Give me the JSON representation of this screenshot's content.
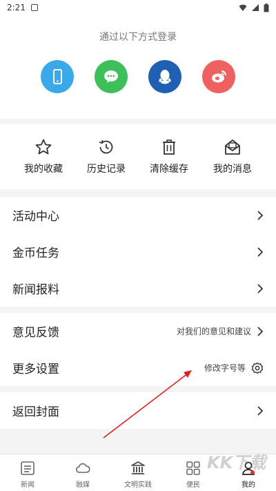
{
  "status_bar": {
    "time": "2:21"
  },
  "login": {
    "title": "通过以下方式登录",
    "methods": [
      {
        "name": "phone",
        "icon": "phone-icon",
        "color": "#3aa9ea"
      },
      {
        "name": "wechat",
        "icon": "wechat-icon",
        "color": "#3dbf5a"
      },
      {
        "name": "qq",
        "icon": "qq-icon",
        "color": "#1f60b5"
      },
      {
        "name": "weibo",
        "icon": "weibo-icon",
        "color": "#ef6060"
      }
    ]
  },
  "quick_actions": [
    {
      "label": "我的收藏",
      "icon": "star-icon"
    },
    {
      "label": "历史记录",
      "icon": "history-icon"
    },
    {
      "label": "清除缓存",
      "icon": "trash-icon"
    },
    {
      "label": "我的消息",
      "icon": "mail-icon"
    }
  ],
  "menu_group1": [
    {
      "label": "活动中心"
    },
    {
      "label": "金币任务"
    },
    {
      "label": "新闻报料"
    }
  ],
  "menu_group2": [
    {
      "label": "意见反馈",
      "hint": "对我们的意见和建议"
    },
    {
      "label": "更多设置",
      "hint": "修改字号等"
    }
  ],
  "menu_group3": [
    {
      "label": "返回封面"
    }
  ],
  "bottom_nav": [
    {
      "label": "新闻",
      "icon": "news-icon"
    },
    {
      "label": "融媒",
      "icon": "cloud-icon"
    },
    {
      "label": "文明实践",
      "icon": "building-icon"
    },
    {
      "label": "便民",
      "icon": "grid-icon"
    },
    {
      "label": "我的",
      "icon": "user-icon",
      "active": true
    }
  ],
  "watermark": "KK下载"
}
